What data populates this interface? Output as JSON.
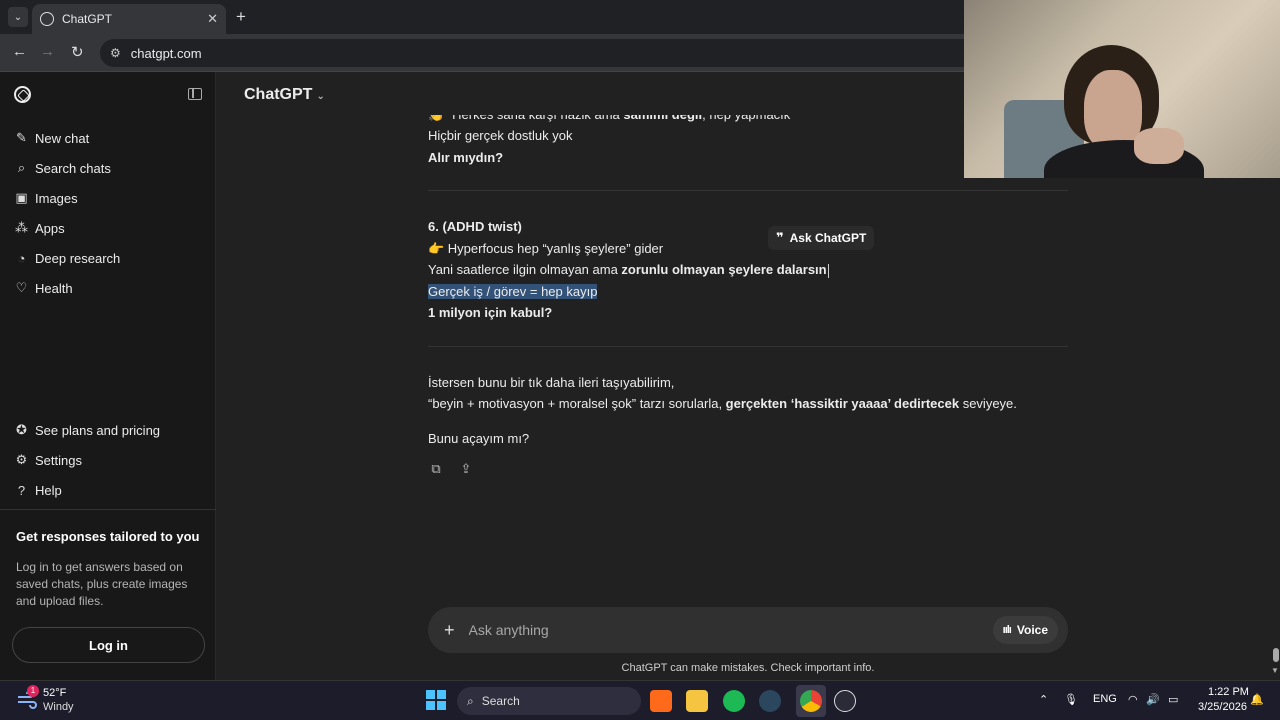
{
  "browser": {
    "tab_title": "ChatGPT",
    "tab_close": "✕",
    "new_tab": "+",
    "url": "chatgpt.com",
    "back": "←",
    "forward": "→",
    "reload": "↻"
  },
  "sidebar": {
    "items": [
      {
        "label": "New chat",
        "icon": "✎"
      },
      {
        "label": "Search chats",
        "icon": "⌕"
      },
      {
        "label": "Images",
        "icon": "▣"
      },
      {
        "label": "Apps",
        "icon": "⁂"
      },
      {
        "label": "Deep research",
        "icon": "◔"
      },
      {
        "label": "Health",
        "icon": "♡"
      }
    ],
    "bottom_items": [
      {
        "label": "See plans and pricing",
        "icon": "✪"
      },
      {
        "label": "Settings",
        "icon": "⚙"
      },
      {
        "label": "Help",
        "icon": "?"
      }
    ],
    "promo_title": "Get responses tailored to you",
    "promo_text": "Log in to get answers based on saved chats, plus create images and upload files.",
    "login_label": "Log in"
  },
  "header": {
    "model": "ChatGPT",
    "chevron": "⌄"
  },
  "chat": {
    "cut_prefix": "👏 “",
    "cut_line": "Herkes sana karşı nazik ama ",
    "cut_bold": "samimi değil",
    "cut_suffix": ", hep yapmacık",
    "line_friendship": "Hiçbir gerçek dostluk yok",
    "line_would_you": "Alır mıydın?",
    "section6_title": "6. (ADHD twist)",
    "section6_line1": "👉 Hyperfocus hep “yanlış şeylere” gider",
    "section6_line2_plain": "Yani saatlerce ilgin olmayan ama ",
    "section6_line2_bold": "zorunlu olmayan şeylere dalarsın",
    "section6_line3": "Gerçek iş / görev = hep kayıp",
    "section6_line4": "1 milyon için kabul?",
    "closing_line1": "İstersen bunu bir tık daha ileri taşıyabilirim,",
    "closing_line2_plain": "“beyin + motivasyon + moralsel şok” tarzı sorularla, ",
    "closing_line2_bold": "gerçekten ‘hassiktir yaaaa’ dedirtecek",
    "closing_line2_end": " seviyeye.",
    "closing_question": "Bunu açayım mı?",
    "ask_popup_icon": "❞",
    "ask_popup_label": "Ask ChatGPT",
    "copy_icon": "⧉",
    "share_icon": "⇪"
  },
  "composer": {
    "plus": "+",
    "placeholder": "Ask anything",
    "voice_icon": "ıılı",
    "voice_label": "Voice",
    "disclaimer": "ChatGPT can make mistakes. Check important info."
  },
  "taskbar": {
    "weather_badge": "1",
    "weather_temp": "52°F",
    "weather_condition": "Windy",
    "search_label": "Search",
    "search_icon": "⌕",
    "tray_chevron": "⌃",
    "mic_icon": "🎙",
    "language": "ENG",
    "wifi_icon": "◠",
    "volume_icon": "🔊",
    "battery_icon": "▭",
    "notification_icon": "🔔",
    "time": "1:22 PM",
    "date": "3/25/2026"
  },
  "colors": {
    "accent_highlight": "#335278",
    "windows_blue": "#4cc2ff",
    "spotify_green": "#1db954",
    "badge_red": "#e0245e"
  }
}
